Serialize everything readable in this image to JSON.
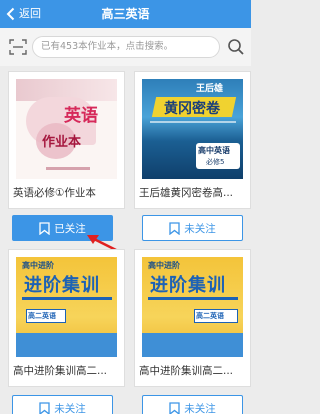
{
  "header": {
    "back_label": "返回",
    "title": "高三英语"
  },
  "search": {
    "placeholder": "已有453本作业本，点击搜索。"
  },
  "books": [
    {
      "title": "英语必修①作业本",
      "follow_label": "已关注",
      "followed": true,
      "cover": {
        "main": "英语",
        "sub": "作业本"
      }
    },
    {
      "title": "王后雄黄冈密卷高...",
      "follow_label": "未关注",
      "followed": false,
      "cover": {
        "main": "黄冈密卷",
        "top": "王后雄",
        "sub": "高中英语",
        "sub2": "必修5"
      }
    },
    {
      "title": "高中进阶集训高二...",
      "follow_label": "未关注",
      "followed": false,
      "cover": {
        "main": "进阶集训",
        "top": "高中进阶",
        "sub": "高二英语"
      }
    },
    {
      "title": "高中进阶集训高二...",
      "follow_label": "未关注",
      "followed": false,
      "cover": {
        "main": "进阶集训",
        "top": "高中进阶",
        "sub": "高二英语"
      }
    }
  ],
  "colors": {
    "accent": "#3c95e6",
    "arrow": "#e02020"
  }
}
